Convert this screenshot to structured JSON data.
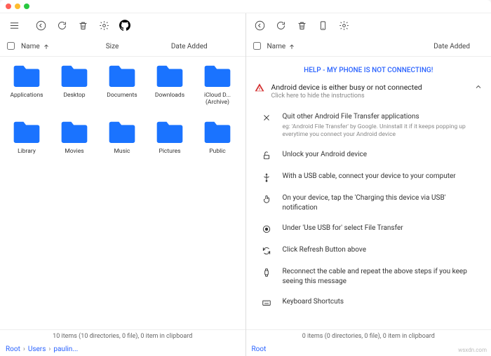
{
  "left": {
    "toolbar": {
      "menu": "menu",
      "back": "back",
      "refresh": "refresh",
      "trash": "trash",
      "gear": "settings",
      "github": "github"
    },
    "header": {
      "name": "Name",
      "size": "Size",
      "date": "Date Added"
    },
    "folders": [
      {
        "name": "Applications"
      },
      {
        "name": "Desktop"
      },
      {
        "name": "Documents"
      },
      {
        "name": "Downloads"
      },
      {
        "name": "iCloud D... (Archive)"
      },
      {
        "name": "Library"
      },
      {
        "name": "Movies"
      },
      {
        "name": "Music"
      },
      {
        "name": "Pictures"
      },
      {
        "name": "Public"
      }
    ],
    "status": "10 items (10 directories, 0 file), 0 item in clipboard",
    "breadcrumb": [
      "Root",
      "Users",
      "paulin..."
    ]
  },
  "right": {
    "toolbar": {
      "back": "back",
      "refresh": "refresh",
      "trash": "trash",
      "phone": "phone",
      "gear": "settings"
    },
    "header": {
      "name": "Name",
      "date": "Date Added"
    },
    "help_link": "HELP - MY PHONE IS NOT CONNECTING!",
    "warn": {
      "title": "Android device is either busy or not connected",
      "sub": "Click here to hide the instructions"
    },
    "steps": [
      {
        "icon": "close",
        "text": "Quit other Android File Transfer applications",
        "sub": "eg: 'Android File Transfer' by Google. Uninstall it if it keeps popping up everytime you connect your Android device"
      },
      {
        "icon": "unlock",
        "text": "Unlock your Android device"
      },
      {
        "icon": "usb",
        "text": "With a USB cable, connect your device to your computer"
      },
      {
        "icon": "touch",
        "text": "On your device, tap the 'Charging this device via USB' notification"
      },
      {
        "icon": "radio",
        "text": "Under 'Use USB for' select File Transfer"
      },
      {
        "icon": "sync",
        "text": "Click Refresh Button above"
      },
      {
        "icon": "watch",
        "text": "Reconnect the cable and repeat the above steps if you keep seeing this message"
      },
      {
        "icon": "keyboard",
        "text": "Keyboard Shortcuts"
      }
    ],
    "status": "0 items (0 directories, 0 file), 0 item in clipboard",
    "breadcrumb": [
      "Root"
    ]
  },
  "source": "wsxdn.com"
}
